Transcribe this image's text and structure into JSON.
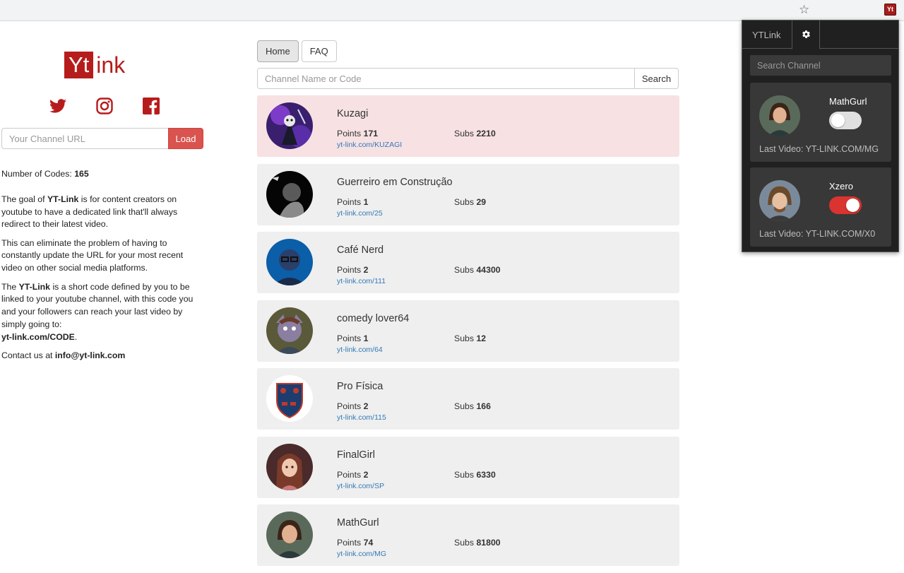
{
  "browser": {
    "star_icon": "star-icon",
    "extension_badge": "Yt"
  },
  "brand": {
    "logo_box": "Yt",
    "logo_rest": "ink",
    "color": "#b71c1c"
  },
  "socials": [
    "twitter-icon",
    "instagram-icon",
    "facebook-icon"
  ],
  "load_form": {
    "placeholder": "Your Channel URL",
    "button": "Load"
  },
  "about": {
    "codes_label": "Number of Codes:",
    "codes_count": "165",
    "p1_a": "The goal of ",
    "p1_b": "YT-Link",
    "p1_c": " is for content creators on youtube to have a dedicated link that'll always redirect to their latest video.",
    "p2": "This can eliminate the problem of having to constantly update the URL for your most recent video on other social media platforms.",
    "p3_a": "The ",
    "p3_b": "YT-Link",
    "p3_c": " is a short code defined by you to be linked to your youtube channel, with this code you and your followers can reach your last video by simply going to:",
    "p3_d": "yt-link.com/CODE",
    "p3_e": ".",
    "contact_a": "Contact us at ",
    "contact_b": "info@yt-link.com"
  },
  "nav": {
    "home": "Home",
    "faq": "FAQ"
  },
  "search": {
    "placeholder": "Channel Name or Code",
    "button": "Search"
  },
  "channel_labels": {
    "points": "Points",
    "subs": "Subs"
  },
  "channels": [
    {
      "name": "Kuzagi",
      "points": "171",
      "subs": "2210",
      "link": "yt-link.com/KUZAGI",
      "highlighted": true
    },
    {
      "name": "Guerreiro em Construção",
      "points": "1",
      "subs": "29",
      "link": "yt-link.com/25",
      "highlighted": false
    },
    {
      "name": "Café Nerd",
      "points": "2",
      "subs": "44300",
      "link": "yt-link.com/111",
      "highlighted": false
    },
    {
      "name": "comedy lover64",
      "points": "1",
      "subs": "12",
      "link": "yt-link.com/64",
      "highlighted": false
    },
    {
      "name": "Pro Física",
      "points": "2",
      "subs": "166",
      "link": "yt-link.com/115",
      "highlighted": false
    },
    {
      "name": "FinalGirl",
      "points": "2",
      "subs": "6330",
      "link": "yt-link.com/SP",
      "highlighted": false
    },
    {
      "name": "MathGurl",
      "points": "74",
      "subs": "81800",
      "link": "yt-link.com/MG",
      "highlighted": false
    }
  ],
  "popup": {
    "tab_label": "YTLink",
    "settings_icon": "gear-icon",
    "search_placeholder": "Search Channel",
    "last_video_label": "Last Video:",
    "subscriptions": [
      {
        "name": "MathGurl",
        "enabled": false,
        "last_video": "YT-LINK.COM/MG"
      },
      {
        "name": "Xzero",
        "enabled": true,
        "last_video": "YT-LINK.COM/X0"
      }
    ],
    "toggle_on_color": "#d9342f",
    "background": "#202020"
  }
}
